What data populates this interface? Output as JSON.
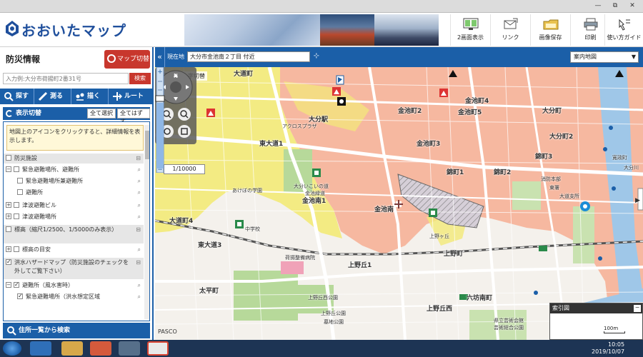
{
  "window": {
    "min_label": "—",
    "max_label": "⧉",
    "close_label": "✕"
  },
  "header": {
    "title": "おおいたマップ",
    "tools": [
      {
        "label": "2画面表示",
        "icon": "dual-screen-icon"
      },
      {
        "label": "リンク",
        "icon": "link-icon"
      },
      {
        "label": "画像保存",
        "icon": "save-image-icon"
      },
      {
        "label": "印刷",
        "icon": "print-icon"
      },
      {
        "label": "使い方ガイド",
        "icon": "guide-icon"
      }
    ]
  },
  "panel": {
    "title": "防災情報",
    "map_switch": "マップ切替",
    "search_placeholder": "入力例:大分市荷揚町2番31号",
    "search_button": "検索",
    "modes": [
      "探す",
      "測る",
      "描く",
      "ルート"
    ],
    "layer_head": "表示切替",
    "select_all": "全て選択",
    "clear_all": "全てはずす",
    "hint": "地図上のアイコンをクリックすると、詳細情報を表示します。",
    "layers": [
      {
        "label": "防災施設",
        "level": 0,
        "checked": false,
        "grey": true,
        "toggle": "⊟"
      },
      {
        "label": "緊急避難場所、避難所",
        "level": 0,
        "checked": false,
        "grey": false,
        "expand": "⊟"
      },
      {
        "label": "緊急避難場所兼避難所",
        "level": 1,
        "checked": false,
        "grey": false
      },
      {
        "label": "避難所",
        "level": 1,
        "checked": false,
        "grey": false
      },
      {
        "label": "津波避難ビル",
        "level": 0,
        "checked": false,
        "grey": false,
        "expand": "⊞"
      },
      {
        "label": "津波避難場所",
        "level": 0,
        "checked": false,
        "grey": false,
        "expand": "⊞"
      },
      {
        "label": "標高（縮尺1/2500、1/5000のみ表示）",
        "level": 0,
        "checked": false,
        "grey": true,
        "toggle": "⊟"
      },
      {
        "label": "標高の目安",
        "level": 0,
        "checked": false,
        "grey": false,
        "expand": "⊞"
      },
      {
        "label": "洪水ハザードマップ（防災施設のチェックを外してご覧下さい）",
        "level": 0,
        "checked": true,
        "grey": true,
        "toggle": "⊟"
      },
      {
        "label": "避難所（風水害時）",
        "level": 0,
        "checked": true,
        "grey": false,
        "expand": "⊟"
      },
      {
        "label": "緊急避難場所（洪水想定区域",
        "level": 1,
        "checked": true,
        "grey": false
      }
    ],
    "address_search": "住所一覧から検索"
  },
  "locbar": {
    "collapse": "«",
    "label": "現在地",
    "location": "大分市金池南２丁目 付近",
    "target": "⊹",
    "map_type": "案内地図",
    "map_type_arrow": "▼"
  },
  "map": {
    "crosshair": "中心十字切替",
    "scale": "1/10000",
    "index_map": "索引図",
    "index_close": "−",
    "scalebar": "100m",
    "credit": "PASCO",
    "labels": [
      {
        "text": "大分駅",
        "sz": "b"
      },
      {
        "text": "東大道1",
        "sz": "b"
      },
      {
        "text": "金池南1",
        "sz": "b"
      },
      {
        "text": "金池南",
        "sz": "b"
      },
      {
        "text": "上野丘1",
        "sz": "b"
      },
      {
        "text": "太平町",
        "sz": "b"
      },
      {
        "text": "上野丘西",
        "sz": "b"
      },
      {
        "text": "六坊南町",
        "sz": "b"
      },
      {
        "text": "大道町4",
        "sz": "b"
      },
      {
        "text": "東大道3",
        "sz": "b"
      },
      {
        "text": "大道町",
        "sz": "b"
      },
      {
        "text": "金池町2",
        "sz": "b"
      },
      {
        "text": "金池町3",
        "sz": "b"
      },
      {
        "text": "金池町5",
        "sz": "b"
      },
      {
        "text": "金池町4",
        "sz": "b"
      },
      {
        "text": "錦町1",
        "sz": "b"
      },
      {
        "text": "錦町2",
        "sz": "b"
      },
      {
        "text": "錦町3",
        "sz": "b"
      },
      {
        "text": "大分町2",
        "sz": "b"
      },
      {
        "text": "上野町",
        "sz": "b"
      },
      {
        "text": "大分町",
        "sz": "b"
      },
      {
        "text": "アクロスプラザ",
        "sz": "s"
      },
      {
        "text": "上野ヶ丘",
        "sz": "s"
      },
      {
        "text": "上野丘西公園",
        "sz": "s"
      },
      {
        "text": "上野丘公園",
        "sz": "s"
      },
      {
        "text": "墓地公園",
        "sz": "s"
      },
      {
        "text": "荷揚整備病院",
        "sz": "s"
      },
      {
        "text": "中学校",
        "sz": "s"
      },
      {
        "text": "あけぼの学園",
        "sz": "s"
      },
      {
        "text": "大分いこいの道",
        "sz": "s"
      },
      {
        "text": "金池緑道",
        "sz": "s"
      },
      {
        "text": "県立芸術会館",
        "sz": "s"
      },
      {
        "text": "芸術総合公園",
        "sz": "s"
      },
      {
        "text": "消防本部",
        "sz": "s"
      },
      {
        "text": "東署",
        "sz": "s"
      },
      {
        "text": "大道支所",
        "sz": "s"
      },
      {
        "text": "寛政町",
        "sz": "s"
      },
      {
        "text": "大分川",
        "sz": "s"
      }
    ]
  },
  "taskbar": {
    "time": "10:05",
    "date": "2019/10/07"
  },
  "colors": {
    "brand_blue": "#1b5fa8",
    "accent_red": "#c8372d",
    "flood_pink": "#f6b8a0",
    "flood_yellow": "#f3ea78"
  }
}
